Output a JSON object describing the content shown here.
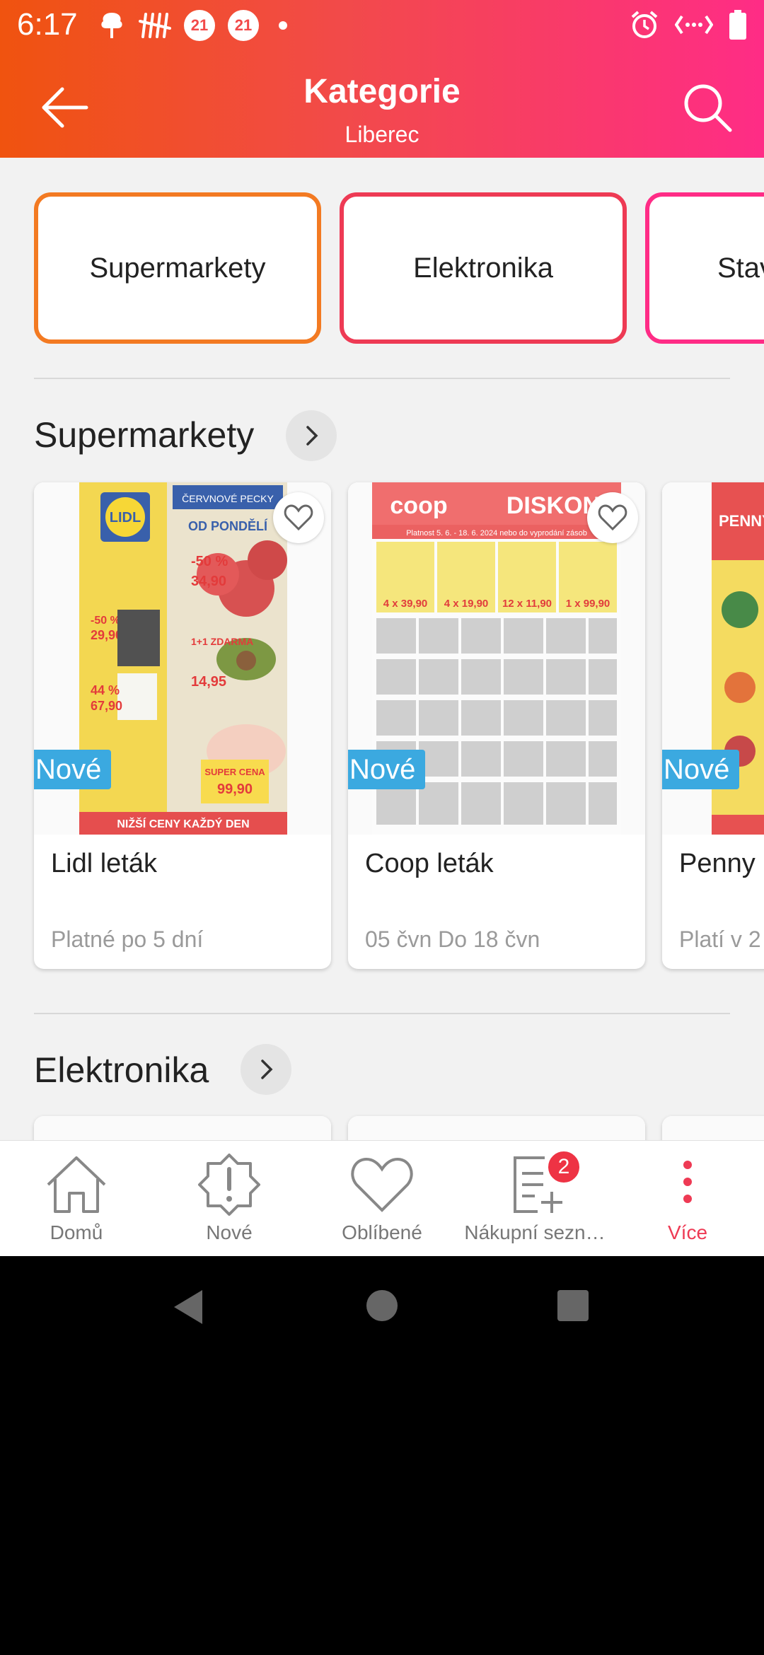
{
  "status_bar": {
    "time": "6:17",
    "badge_1": "21",
    "badge_2": "21"
  },
  "header": {
    "title": "Kategorie",
    "subtitle": "Liberec",
    "back_icon": "arrow-left-icon",
    "search_icon": "search-icon"
  },
  "categories": [
    {
      "label": "Supermarkety"
    },
    {
      "label": "Elektronika"
    },
    {
      "label": "Stav"
    }
  ],
  "sections": [
    {
      "title": "Supermarkety"
    },
    {
      "title": "Elektronika"
    }
  ],
  "flyers": [
    {
      "name": "Lidl leták",
      "valid": "Platné po 5 dní",
      "badge": "Nové",
      "cover_text": [
        "ČERVNOVÉ PECKY",
        "OD PONDĚLÍ",
        "-50 %",
        "34,90",
        "14,95",
        "-50 %",
        "29,90",
        "44 %",
        "67,90",
        "1+1 ZDARMA",
        "SUPER CENA",
        "99,90",
        "NIŽŠÍ CENY KAŽDÝ DEN"
      ]
    },
    {
      "name": "Coop leták",
      "valid": "05 čvn Do 18 čvn",
      "badge": "Nové",
      "cover_text": [
        "coop",
        "DISKON",
        "Platnost 5. 6. - 18. 6. 2024 nebo do vyprodání zásob",
        "4 x 39,90",
        "4 x 19,90",
        "12 x 11,90",
        "1 x 99,90"
      ]
    },
    {
      "name": "Penny",
      "valid": "Platí v 2",
      "badge": "Nové",
      "cover_text": [
        "PENNY"
      ]
    }
  ],
  "bottom_nav": [
    {
      "label": "Domů",
      "icon": "home-icon"
    },
    {
      "label": "Nové",
      "icon": "alert-icon"
    },
    {
      "label": "Oblíbené",
      "icon": "heart-icon"
    },
    {
      "label": "Nákupní sezn…",
      "icon": "shopping-list-icon",
      "badge": "2"
    },
    {
      "label": "Více",
      "icon": "more-icon",
      "active": true
    }
  ],
  "colors": {
    "header_gradient_start": "#f0530f",
    "header_gradient_end": "#ff2c86",
    "active_nav": "#ee3a54",
    "new_badge": "#3ba9e0"
  }
}
